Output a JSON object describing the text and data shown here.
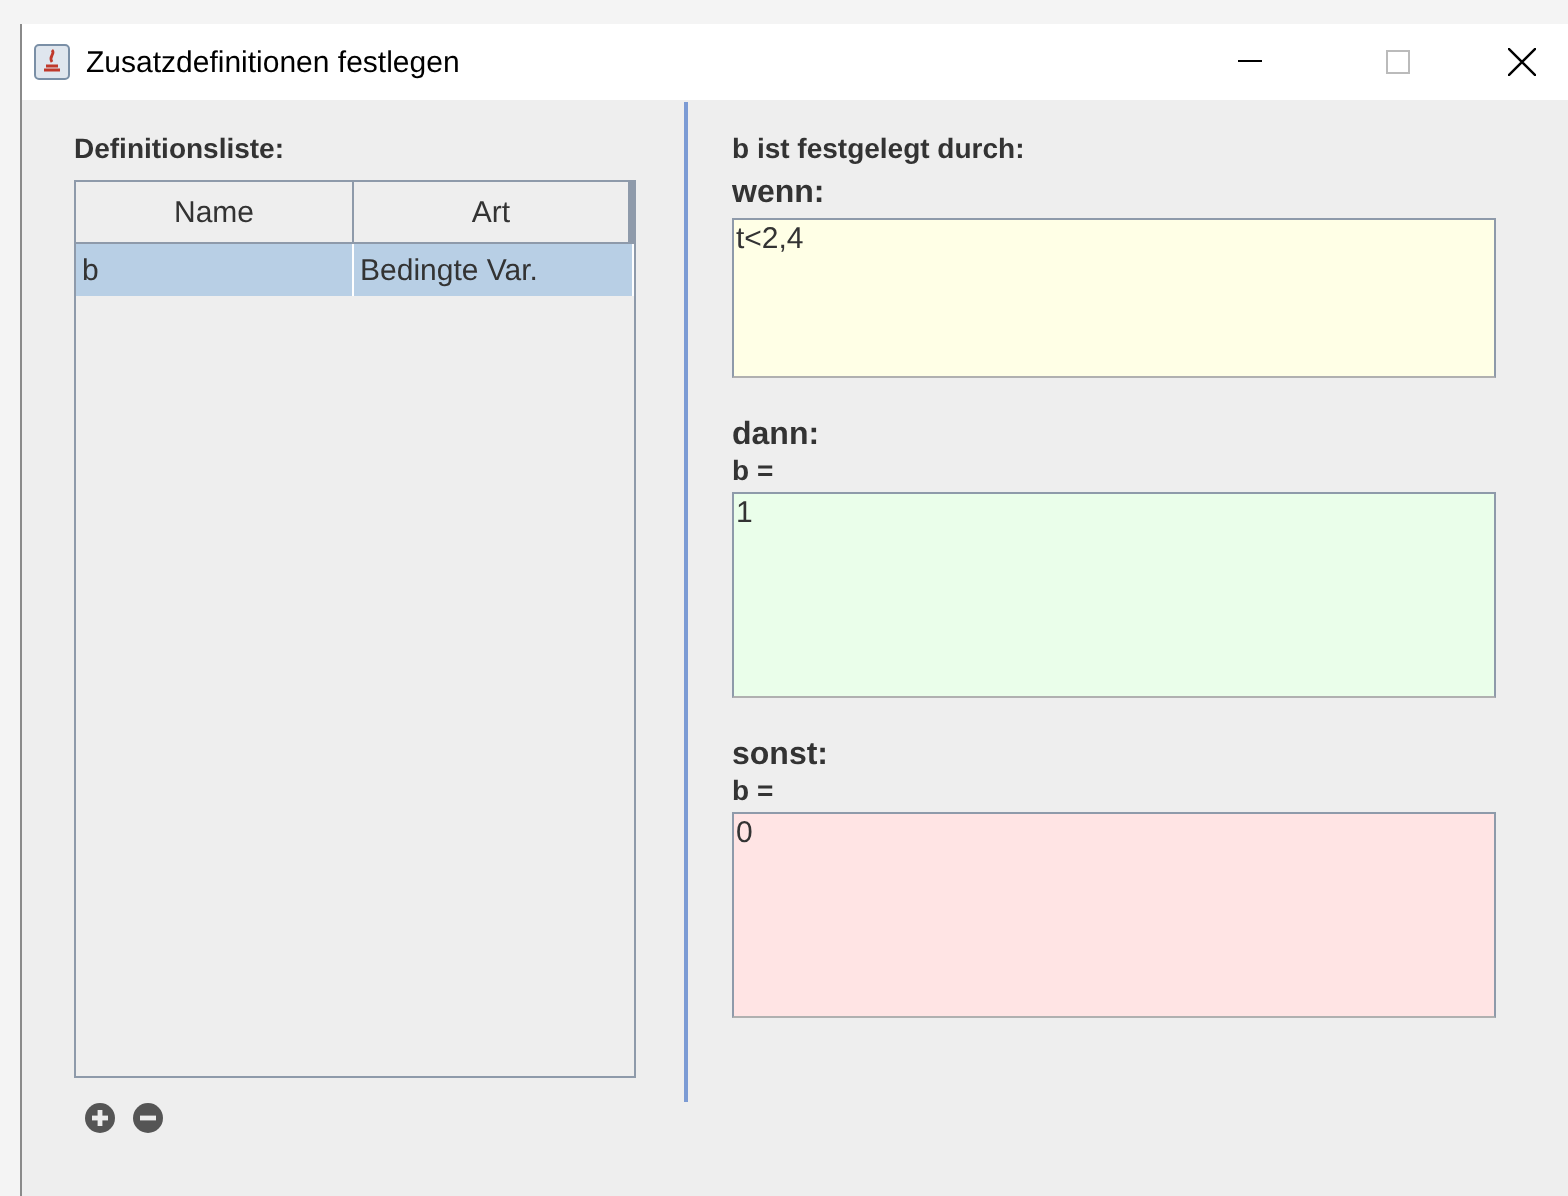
{
  "window": {
    "title": "Zusatzdefinitionen festlegen"
  },
  "definitions": {
    "label": "Definitionsliste:",
    "columns": [
      "Name",
      "Art"
    ],
    "rows": [
      {
        "cells": [
          "b",
          "Bedingte Var."
        ],
        "selected": true
      }
    ]
  },
  "definition": {
    "title": "b ist festgelegt durch:",
    "sections": [
      {
        "heading": "wenn:",
        "value": "t<2,4",
        "color": "#ffffe6"
      },
      {
        "heading": "dann:",
        "sublabel": "b =",
        "value": "1",
        "color": "#eafeea"
      },
      {
        "heading": "sonst:",
        "sublabel": "b =",
        "value": "0",
        "color": "#ffe4e4"
      }
    ]
  }
}
